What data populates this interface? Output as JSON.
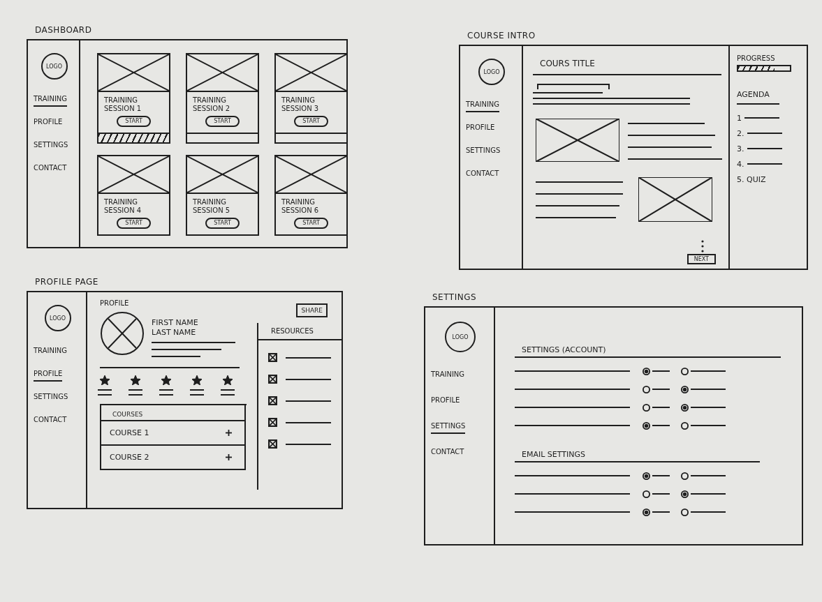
{
  "screens": [
    {
      "kind": "dashboard",
      "title": "DASHBOARD",
      "sidebar": {
        "logo": "LOGO",
        "items": [
          {
            "label": "TRAINING",
            "selected": true
          },
          {
            "label": "PROFILE",
            "selected": false
          },
          {
            "label": "SETTINGS",
            "selected": false
          },
          {
            "label": "CONTACT",
            "selected": false
          }
        ]
      },
      "cards": [
        {
          "title": "TRAINING SESSION 1",
          "button": "START",
          "progress": {
            "level": 1
          }
        },
        {
          "title": "TRAINING SESSION 2",
          "button": "START",
          "progress": {
            "level": 0
          }
        },
        {
          "title": "TRAINING SESSION 3",
          "button": "START",
          "progress": {
            "level": 0
          }
        },
        {
          "title": "TRAINING SESSION 4",
          "button": "START"
        },
        {
          "title": "TRAINING SESSION 5",
          "button": "START"
        },
        {
          "title": "TRAINING SESSION 6",
          "button": "START"
        }
      ]
    },
    {
      "kind": "course_intro",
      "title": "COURSE INTRO",
      "sidebar": {
        "logo": "LOGO",
        "items": [
          {
            "label": "TRAINING",
            "selected": true
          },
          {
            "label": "PROFILE",
            "selected": false
          },
          {
            "label": "SETTINGS",
            "selected": false
          },
          {
            "label": "CONTACT",
            "selected": false
          }
        ]
      },
      "course_title": "COURS TITLE",
      "next_button": "NEXT",
      "progress": {
        "label": "PROGRESS",
        "level": 0.7
      },
      "agenda": {
        "heading": "AGENDA",
        "items": [
          {
            "kind": "lesson",
            "label": "1"
          },
          {
            "kind": "lesson",
            "label": "2."
          },
          {
            "kind": "lesson",
            "label": "3."
          },
          {
            "kind": "lesson",
            "label": "4."
          },
          {
            "kind": "quiz",
            "label": "5. QUIZ"
          }
        ]
      }
    },
    {
      "kind": "profile",
      "title": "PROFILE PAGE",
      "sidebar": {
        "logo": "LOGO",
        "items": [
          {
            "label": "TRAINING",
            "selected": false
          },
          {
            "label": "PROFILE",
            "selected": true
          },
          {
            "label": "SETTINGS",
            "selected": false
          },
          {
            "label": "CONTACT",
            "selected": false
          }
        ]
      },
      "heading": "PROFILE",
      "share_button": "SHARE",
      "first_name": "FIRST NAME",
      "last_name": "LAST NAME",
      "stars": 5,
      "courses": {
        "heading": "COURSES",
        "rows": [
          "COURSE 1",
          "COURSE 2"
        ]
      },
      "resources": {
        "heading": "RESOURCES",
        "items": [
          {
            "checked": true
          },
          {
            "checked": true
          },
          {
            "checked": true
          },
          {
            "checked": true
          },
          {
            "checked": true
          }
        ]
      }
    },
    {
      "kind": "settings",
      "title": "SETTINGS",
      "sidebar": {
        "logo": "LOGO",
        "items": [
          {
            "label": "TRAINING",
            "selected": false
          },
          {
            "label": "PROFILE",
            "selected": false
          },
          {
            "label": "SETTINGS",
            "selected": true
          },
          {
            "label": "CONTACT",
            "selected": false
          }
        ]
      },
      "sections": [
        {
          "heading": "SETTINGS (ACCOUNT)",
          "rows": [
            {
              "options": [
                {
                  "selected": true
                },
                {
                  "selected": false
                }
              ]
            },
            {
              "options": [
                {
                  "selected": false
                },
                {
                  "selected": true
                }
              ]
            },
            {
              "options": [
                {
                  "selected": false
                },
                {
                  "selected": true
                }
              ]
            },
            {
              "options": [
                {
                  "selected": true
                },
                {
                  "selected": false
                }
              ]
            }
          ]
        },
        {
          "heading": "EMAIL SETTINGS",
          "rows": [
            {
              "options": [
                {
                  "selected": true
                },
                {
                  "selected": false
                }
              ]
            },
            {
              "options": [
                {
                  "selected": false
                },
                {
                  "selected": true
                }
              ]
            },
            {
              "options": [
                {
                  "selected": true
                },
                {
                  "selected": false
                }
              ]
            }
          ]
        }
      ]
    }
  ]
}
